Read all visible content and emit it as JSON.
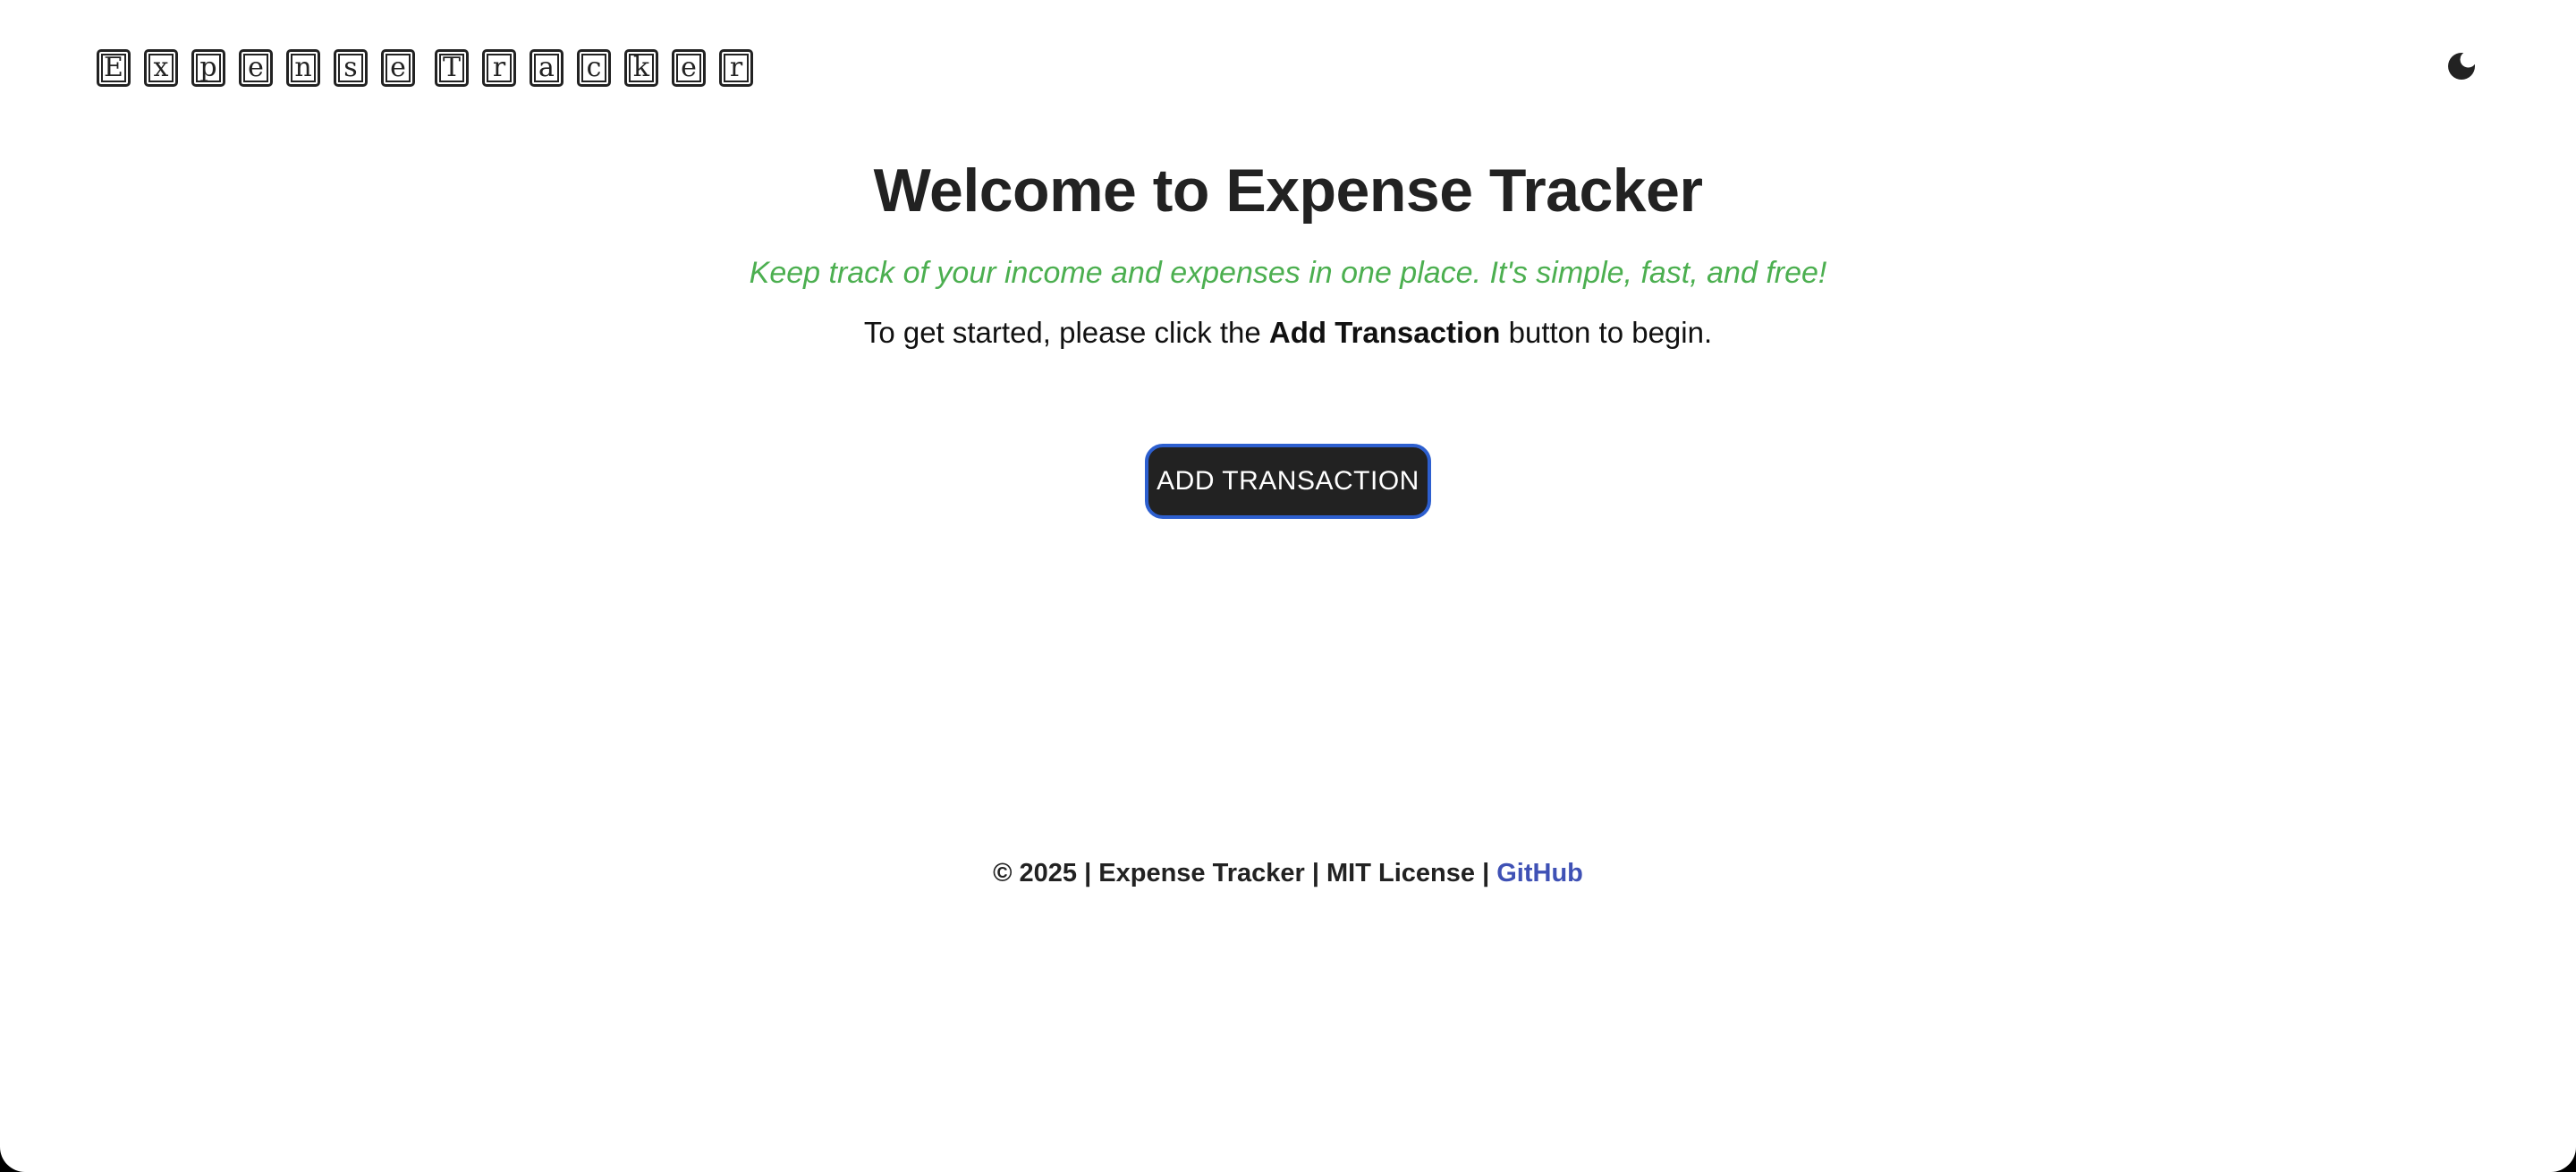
{
  "header": {
    "logo_letters": [
      "E",
      "x",
      "p",
      "e",
      "n",
      "s",
      "e",
      " ",
      "T",
      "r",
      "a",
      "c",
      "k",
      "e",
      "r"
    ],
    "theme_toggle_icon": "moon-icon"
  },
  "main": {
    "title": "Welcome to Expense Tracker",
    "tagline": "Keep track of your income and expenses in one place. It's simple, fast, and free!",
    "instructions_prefix": "To get started, please click the ",
    "instructions_bold": "Add Transaction",
    "instructions_suffix": " button to begin.",
    "add_button_label": "ADD TRANSACTION"
  },
  "footer": {
    "copyright_text": "© 2025 | Expense Tracker | MIT License | ",
    "github_link": "GitHub"
  },
  "colors": {
    "tagline": "#4caf50",
    "button_bg": "#222222",
    "button_border": "#2d5fcf",
    "link": "#3f51b5"
  }
}
